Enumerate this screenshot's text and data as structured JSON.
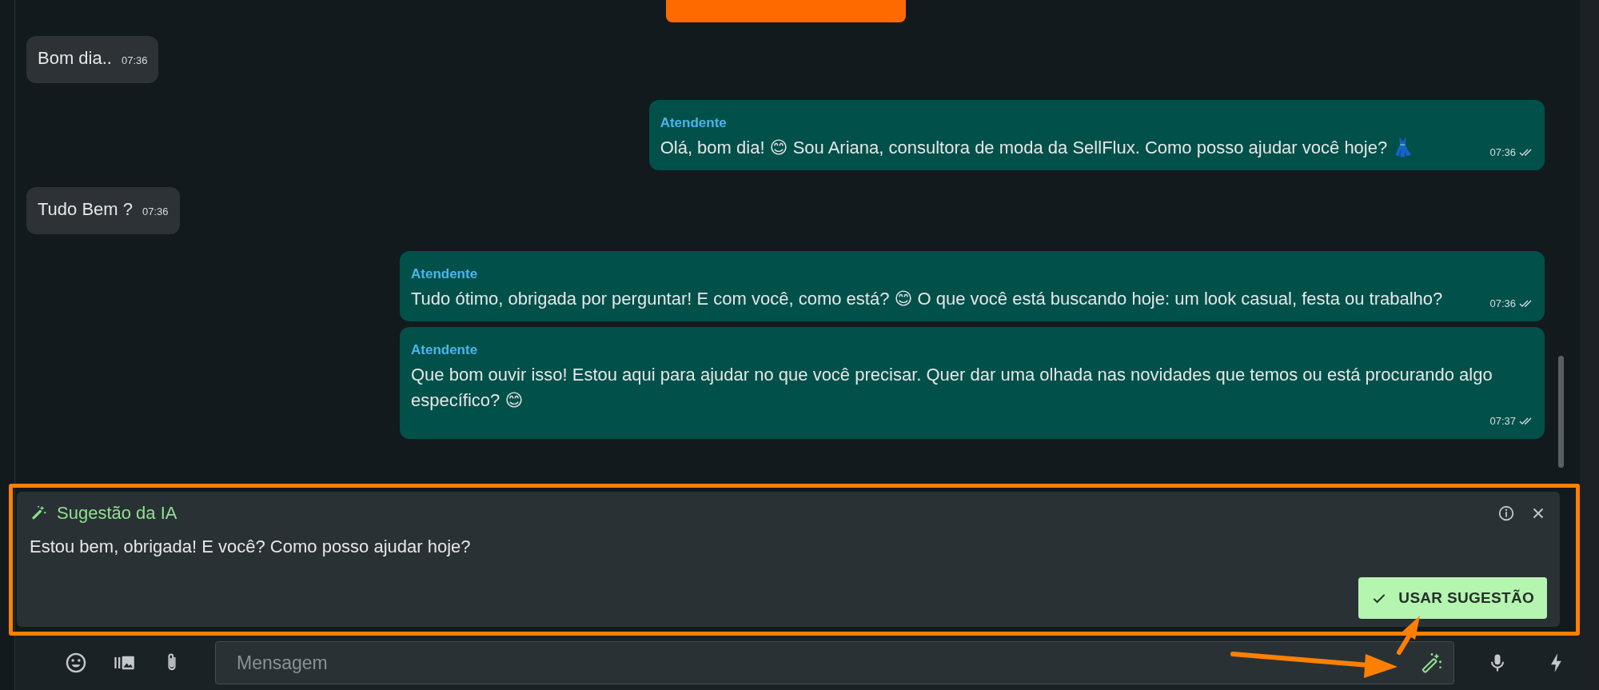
{
  "messages": [
    {
      "kind": "incoming",
      "text": "Bom dia..",
      "time": "07:36"
    },
    {
      "kind": "outgoing",
      "sender": "Atendente",
      "text": "Olá, bom dia! 😊 Sou Ariana, consultora de moda da SellFlux. Como posso ajudar você hoje? 👗",
      "time": "07:36",
      "read": true
    },
    {
      "kind": "incoming",
      "text": "Tudo Bem ?",
      "time": "07:36"
    },
    {
      "kind": "outgoing",
      "sender": "Atendente",
      "text": "Tudo ótimo, obrigada por perguntar! E com você, como está? 😊 O que você está buscando hoje: um look casual, festa ou trabalho?",
      "time": "07:36",
      "read": true
    },
    {
      "kind": "outgoing",
      "sender": "Atendente",
      "text": "Que bom ouvir isso! Estou aqui para ajudar no que você precisar. Quer dar uma olhada nas novidades que temos ou está procurando algo específico? 😊",
      "time": "07:37",
      "read": true
    }
  ],
  "ai_suggestion": {
    "title": "Sugestão da IA",
    "text": "Estou bem, obrigada! E você? Como posso ajudar hoje?",
    "button": "USAR SUGESTÃO"
  },
  "composer": {
    "placeholder": "Mensagem"
  }
}
